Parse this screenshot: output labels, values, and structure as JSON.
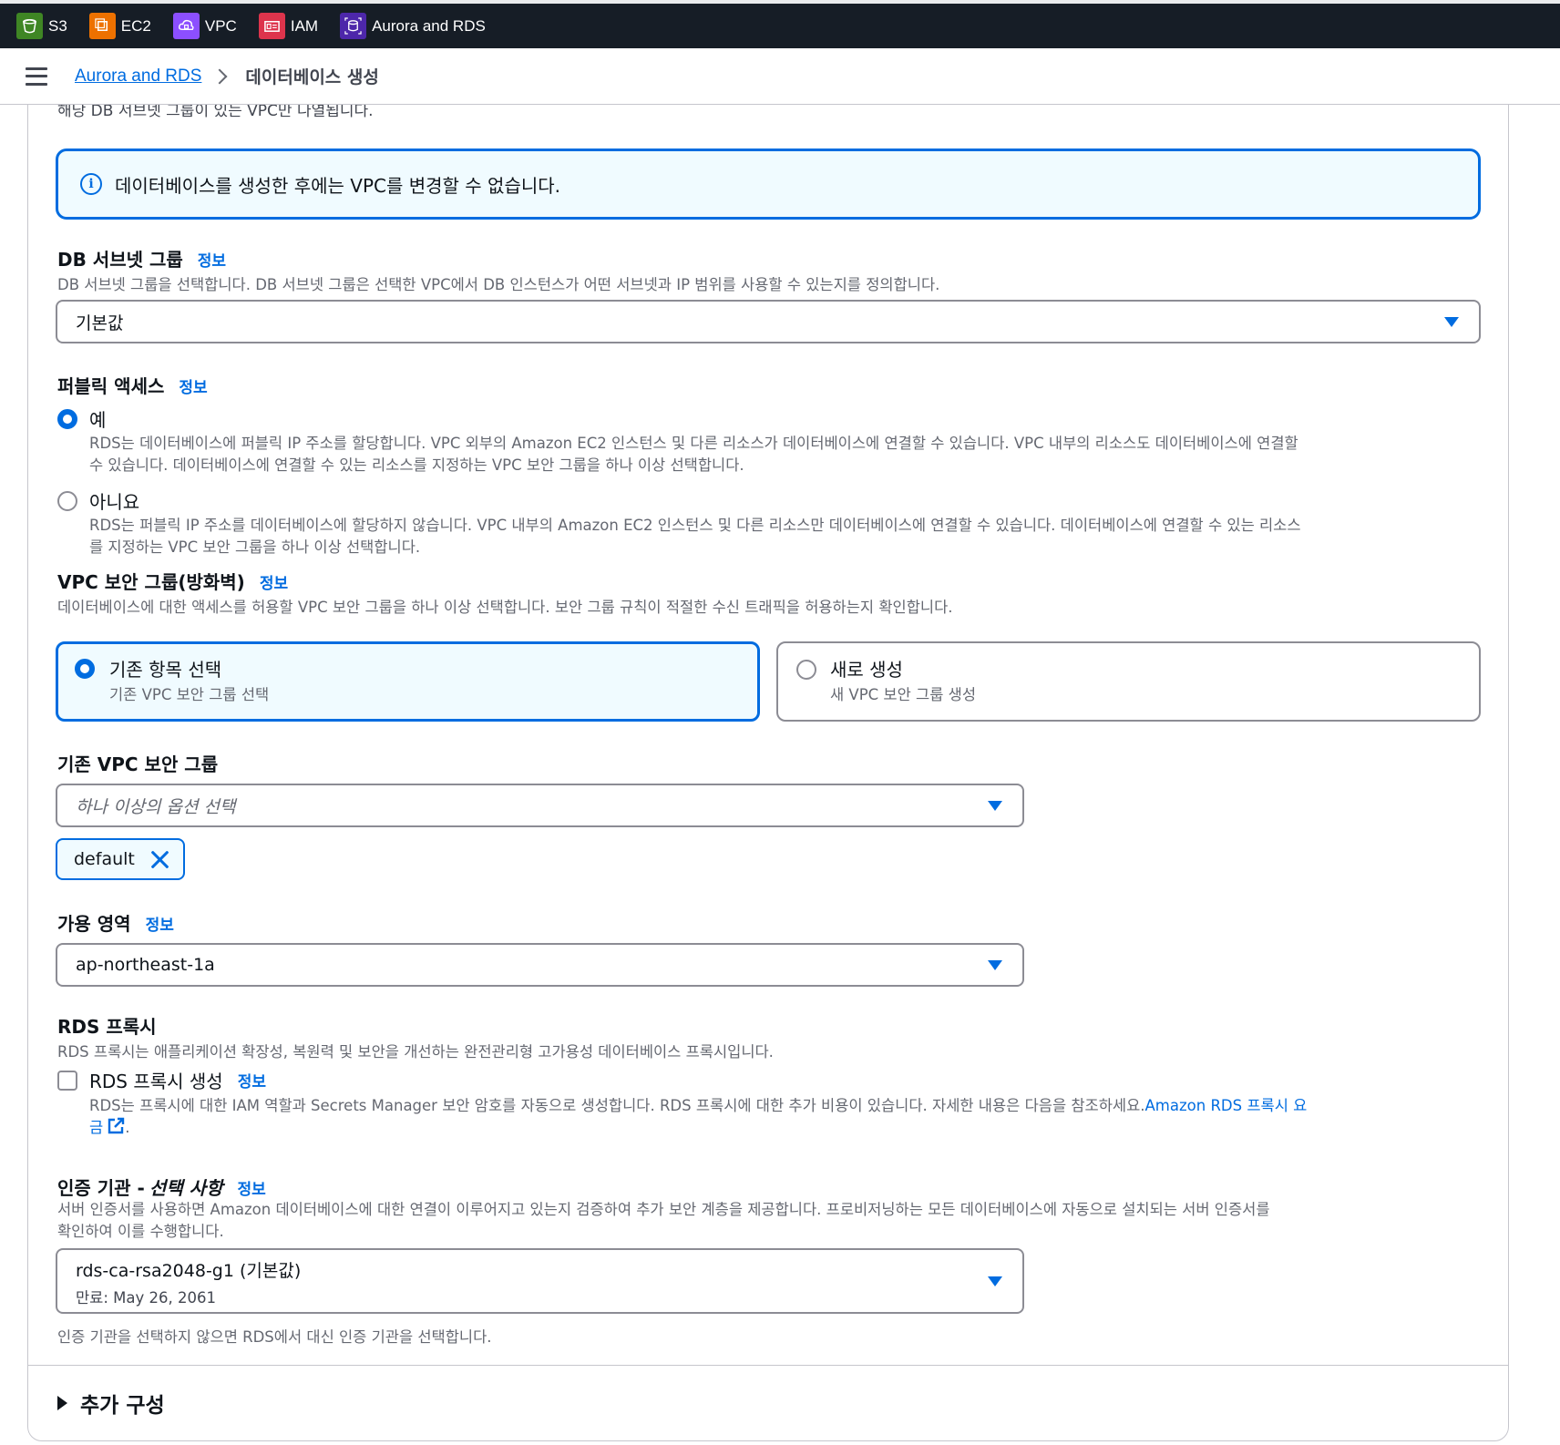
{
  "services": [
    {
      "label": "S3",
      "icon": "s3-icon",
      "color": "#3f8624"
    },
    {
      "label": "EC2",
      "icon": "ec2-icon",
      "color": "#ed7100"
    },
    {
      "label": "VPC",
      "icon": "vpc-icon",
      "color": "#8c4fff"
    },
    {
      "label": "IAM",
      "icon": "iam-icon",
      "color": "#dd344c"
    },
    {
      "label": "Aurora and RDS",
      "icon": "rds-icon",
      "color": "#4d27aa"
    }
  ],
  "breadcrumb": {
    "parent": "Aurora and RDS",
    "current": "데이터베이스 생성"
  },
  "cutoff_text": "해당 DB 서브넷 그룹이 있는 VPC만 나열됩니다.",
  "alert": {
    "text": "데이터베이스를 생성한 후에는 VPC를 변경할 수 없습니다."
  },
  "info_link_label": "정보",
  "db_subnet_group": {
    "label": "DB 서브넷 그룹",
    "description": "DB 서브넷 그룹을 선택합니다. DB 서브넷 그룹은 선택한 VPC에서 DB 인스턴스가 어떤 서브넷과 IP 범위를 사용할 수 있는지를 정의합니다.",
    "value": "기본값"
  },
  "public_access": {
    "label": "퍼블릭 액세스",
    "selected": "yes",
    "options": [
      {
        "title": "예",
        "description_1": "RDS는 데이터베이스에 퍼블릭 IP 주소를 할당합니다. VPC 외부의 Amazon EC2 인스턴스 및 다른 리소스가 데이터베이스에 연결할 수 있습니다. VPC 내부의 리소스도 데이터베이스에 연결할",
        "description_2": "수 있습니다. 데이터베이스에 연결할 수 있는 리소스를 지정하는 VPC 보안 그룹을 하나 이상 선택합니다."
      },
      {
        "title": "아니요",
        "description_1": "RDS는 퍼블릭 IP 주소를 데이터베이스에 할당하지 않습니다. VPC 내부의 Amazon EC2 인스턴스 및 다른 리소스만 데이터베이스에 연결할 수 있습니다. 데이터베이스에 연결할 수 있는 리소스",
        "description_2": "를 지정하는 VPC 보안 그룹을 하나 이상 선택합니다."
      }
    ]
  },
  "vpc_security_group": {
    "label": "VPC 보안 그룹(방화벽)",
    "description": "데이터베이스에 대한 액세스를 허용할 VPC 보안 그룹을 하나 이상 선택합니다. 보안 그룹 규칙이 적절한 수신 트래픽을 허용하는지 확인합니다.",
    "selected": "existing",
    "tiles": [
      {
        "title": "기존 항목 선택",
        "subtitle": "기존 VPC 보안 그룹 선택"
      },
      {
        "title": "새로 생성",
        "subtitle": "새 VPC 보안 그룹 생성"
      }
    ]
  },
  "existing_vpc_sg": {
    "label": "기존 VPC 보안 그룹",
    "placeholder": "하나 이상의 옵션 선택",
    "tokens": [
      "default"
    ]
  },
  "availability_zone": {
    "label": "가용 영역",
    "value": "ap-northeast-1a"
  },
  "rds_proxy": {
    "label": "RDS 프록시",
    "description": "RDS 프록시는 애플리케이션 확장성, 복원력 및 보안을 개선하는 완전관리형 고가용성 데이터베이스 프록시입니다.",
    "checkbox_label": "RDS 프록시 생성",
    "checked": false,
    "help_text": "RDS는 프록시에 대한 IAM 역할과 Secrets Manager 보안 암호를 자동으로 생성합니다. RDS 프록시에 대한 추가 비용이 있습니다. 자세한 내용은 다음을 참조하세요.",
    "pricing_link_1": "Amazon RDS 프록시 요",
    "pricing_link_2": "금",
    "trailing_period": "."
  },
  "certificate_authority": {
    "label": "인증 기관 -",
    "label_optional": "선택 사항",
    "description_1": "서버 인증서를 사용하면 Amazon 데이터베이스에 대한 연결이 이루어지고 있는지 검증하여 추가 보안 계층을 제공합니다. 프로비저닝하는 모든 데이터베이스에 자동으로 설치되는 서버 인증서를",
    "description_2": "확인하여 이를 수행합니다.",
    "value": "rds-ca-rsa2048-g1 (기본값)",
    "expiry": "만료: May 26, 2061",
    "footer": "인증 기관을 선택하지 않으면 RDS에서 대신 인증 기관을 선택합니다."
  },
  "additional_config": {
    "label": "추가 구성"
  }
}
